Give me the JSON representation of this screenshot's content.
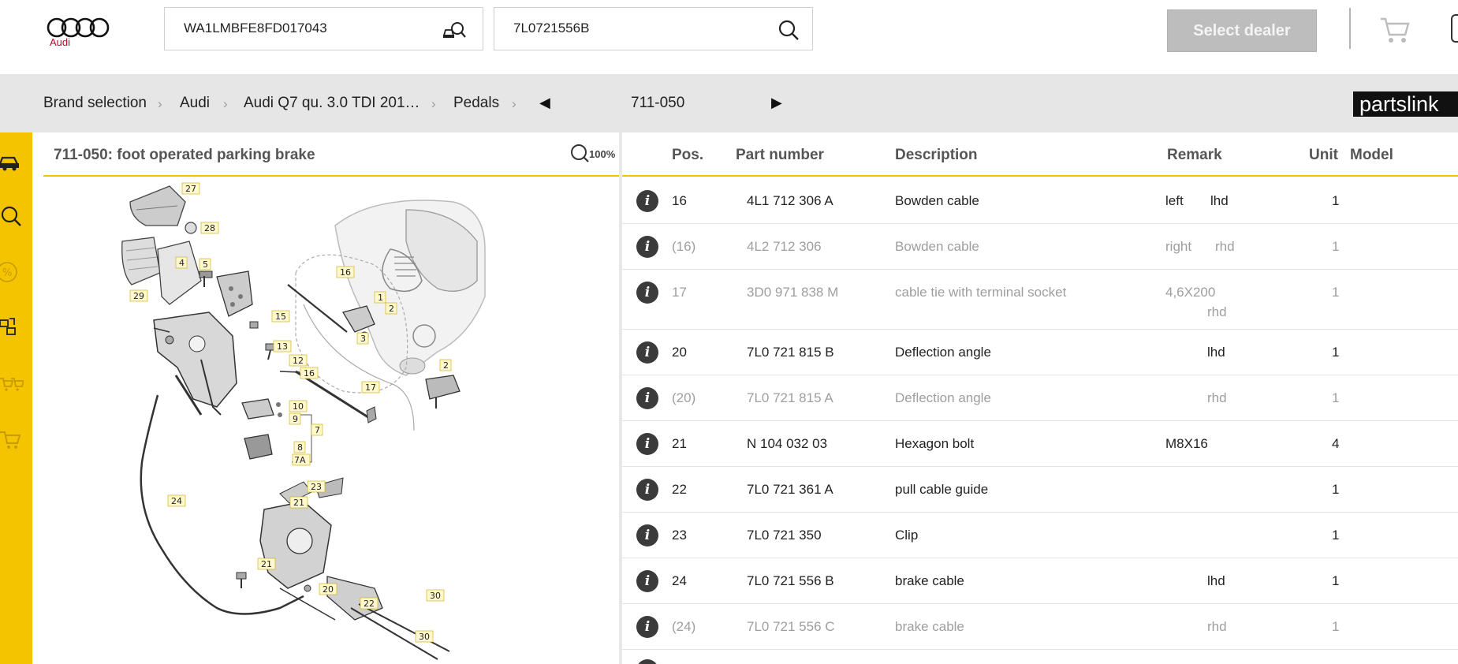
{
  "header": {
    "logo_label": "Audi",
    "vin_value": "WA1LMBFE8FD017043",
    "part_search_value": "7L0721556B",
    "dealer_button": "Select dealer"
  },
  "breadcrumb": {
    "items": [
      "Brand selection",
      "Audi",
      "Audi Q7 qu. 3.0 TDI 201…",
      "Pedals"
    ],
    "current": "711-050",
    "brand_badge": "partslink"
  },
  "illustration": {
    "title": "711-050: foot operated parking brake",
    "zoom_label": "100%",
    "callouts": [
      "27",
      "28",
      "4",
      "5",
      "29",
      "15",
      "16",
      "1",
      "2",
      "3",
      "13",
      "12",
      "16",
      "17",
      "2",
      "10",
      "9",
      "8",
      "7",
      "7A",
      "24",
      "23",
      "21",
      "21",
      "20",
      "22",
      "30",
      "30"
    ]
  },
  "table": {
    "headers": {
      "pos": "Pos.",
      "part": "Part number",
      "desc": "Description",
      "remark": "Remark",
      "unit": "Unit",
      "model": "Model"
    },
    "rows": [
      {
        "pos": "16",
        "part": "4L1 712 306 A",
        "desc": "Bowden cable",
        "remark": "left",
        "remark2": "lhd",
        "unit": "1",
        "dim": false
      },
      {
        "pos": "(16)",
        "part": "4L2 712 306",
        "desc": "Bowden cable",
        "remark": "right",
        "remark2": "rhd",
        "unit": "1",
        "dim": true
      },
      {
        "pos": "17",
        "part": "3D0 971 838 M",
        "desc": "cable tie with terminal socket",
        "remark": "4,6X200",
        "remark2": "rhd",
        "unit": "1",
        "dim": true
      },
      {
        "pos": "20",
        "part": "7L0 721 815 B",
        "desc": "Deflection angle",
        "remark": "",
        "remark2": "lhd",
        "unit": "1",
        "dim": false
      },
      {
        "pos": "(20)",
        "part": "7L0 721 815 A",
        "desc": "Deflection angle",
        "remark": "",
        "remark2": "rhd",
        "unit": "1",
        "dim": true
      },
      {
        "pos": "21",
        "part": "N   104 032 03",
        "desc": "Hexagon bolt",
        "remark": "M8X16",
        "remark2": "",
        "unit": "4",
        "dim": false
      },
      {
        "pos": "22",
        "part": "7L0 721 361 A",
        "desc": "pull cable guide",
        "remark": "",
        "remark2": "",
        "unit": "1",
        "dim": false
      },
      {
        "pos": "23",
        "part": "7L0 721 350",
        "desc": "Clip",
        "remark": "",
        "remark2": "",
        "unit": "1",
        "dim": false
      },
      {
        "pos": "24",
        "part": "7L0 721 556 B",
        "desc": "brake cable",
        "remark": "",
        "remark2": "lhd",
        "unit": "1",
        "dim": false
      },
      {
        "pos": "(24)",
        "part": "7L0 721 556 C",
        "desc": "brake cable",
        "remark": "",
        "remark2": "rhd",
        "unit": "1",
        "dim": true
      }
    ]
  },
  "colors": {
    "accent": "#f5c400",
    "audi_red": "#bb0a30",
    "dim_text": "#9e9e9e"
  },
  "sidebar_icons": [
    "car-icon",
    "search-icon",
    "percent-icon",
    "swap-icon",
    "multi-cart-icon",
    "cart-icon"
  ]
}
